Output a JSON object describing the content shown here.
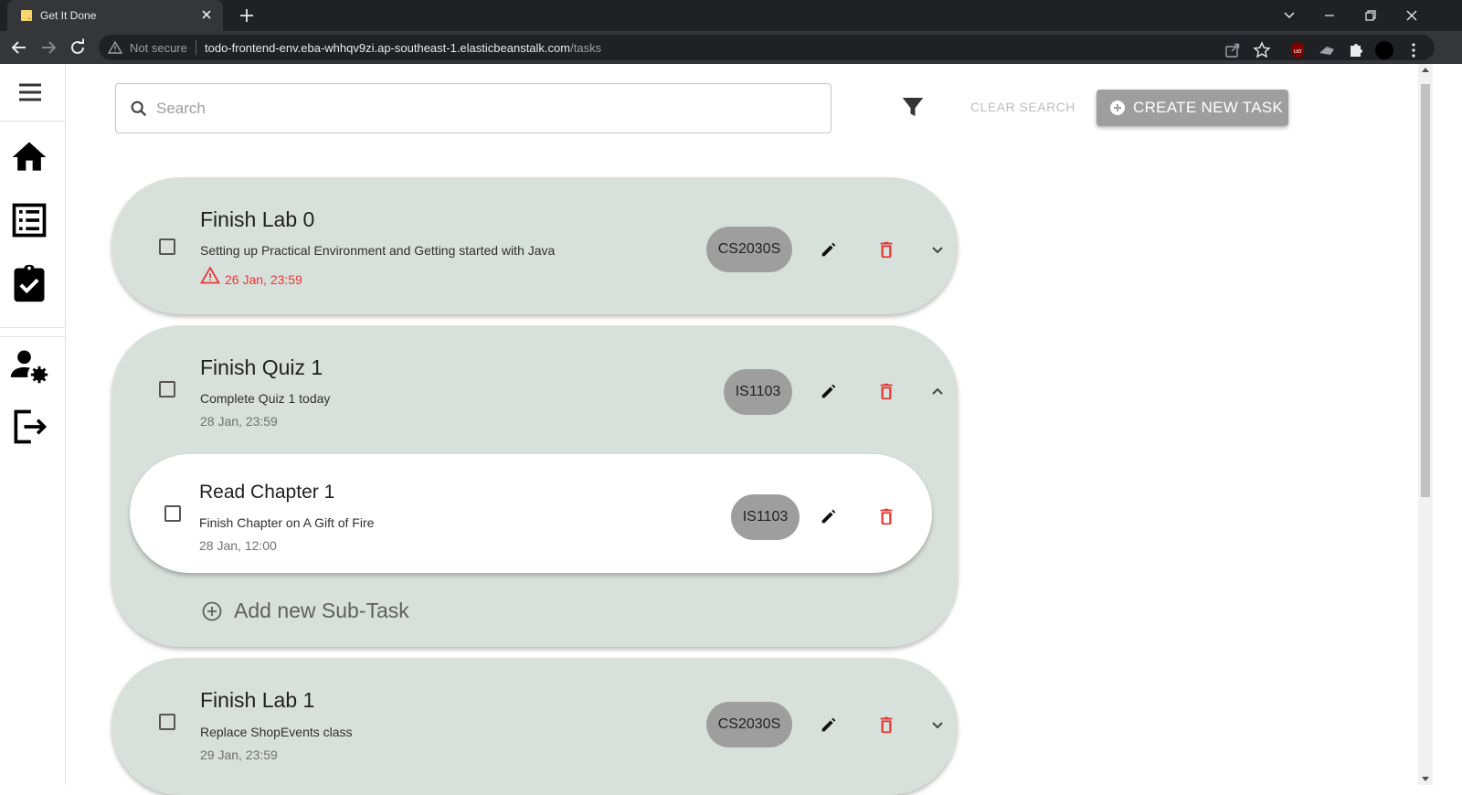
{
  "browser": {
    "tab_title": "Get It Done",
    "omnibox_security": "Not secure",
    "url_host": "todo-frontend-env.eba-whhqv9zi.ap-southeast-1.elasticbeanstalk.com",
    "url_path": "/tasks"
  },
  "sidebar": {
    "items": [
      {
        "icon": "home-icon"
      },
      {
        "icon": "task-list-icon"
      },
      {
        "icon": "assignment-done-icon"
      },
      {
        "icon": "user-settings-icon"
      },
      {
        "icon": "logout-icon"
      }
    ]
  },
  "toolbar": {
    "search_placeholder": "Search",
    "clear_search_label": "CLEAR SEARCH",
    "create_label": "CREATE NEW TASK"
  },
  "colors": {
    "card_bg": "#d8e0dc",
    "chip_bg": "#9e9e9e",
    "delete": "#e53935",
    "overdue": "#e53935"
  },
  "tasks": [
    {
      "title": "Finish Lab 0",
      "description": "Setting up Practical Environment and Getting started with Java",
      "due": "26 Jan, 23:59",
      "overdue": true,
      "module": "CS2030S",
      "expanded": false
    },
    {
      "title": "Finish Quiz 1",
      "description": "Complete Quiz 1 today",
      "due": "28 Jan, 23:59",
      "overdue": false,
      "module": "IS1103",
      "expanded": true,
      "subtasks": [
        {
          "title": "Read Chapter 1",
          "description": "Finish Chapter on A Gift of Fire",
          "due": "28 Jan, 12:00",
          "module": "IS1103"
        }
      ],
      "add_subtask_label": "Add new Sub-Task"
    },
    {
      "title": "Finish Lab 1",
      "description": "Replace ShopEvents class",
      "due": "29 Jan, 23:59",
      "overdue": false,
      "module": "CS2030S",
      "expanded": false
    }
  ]
}
